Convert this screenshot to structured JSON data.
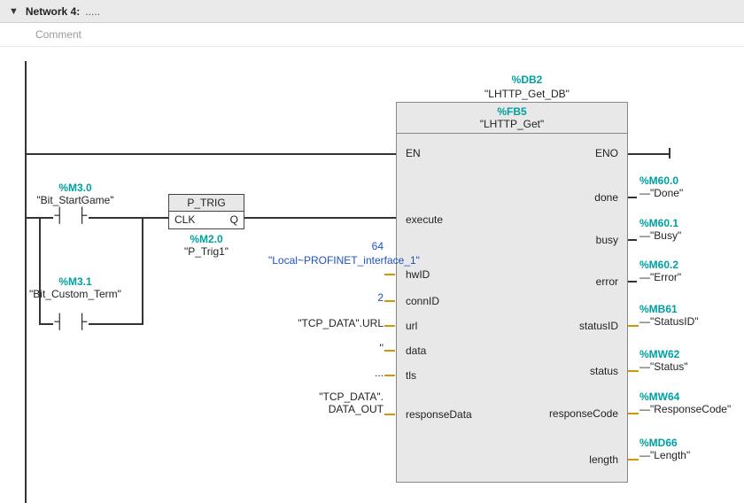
{
  "header": {
    "network_label": "Network 4:",
    "dots": ".....",
    "comment_placeholder": "Comment"
  },
  "left_rung": {
    "contact1": {
      "address": "%M3.0",
      "symbol": "\"Bit_StartGame\""
    },
    "contact2": {
      "address": "%M3.1",
      "symbol": "\"Bit_Custom_Term\""
    },
    "ptrig": {
      "title": "P_TRIG",
      "clk": "CLK",
      "q": "Q",
      "inst_addr": "%M2.0",
      "inst_sym": "\"P_Trig1\""
    }
  },
  "block": {
    "db_addr": "%DB2",
    "db_sym": "\"LHTTP_Get_DB\"",
    "fb_addr": "%FB5",
    "fb_sym": "\"LHTTP_Get\"",
    "ports_left": {
      "en": "EN",
      "execute": "execute",
      "hwid": "hwID",
      "connid": "connID",
      "url": "url",
      "data": "data",
      "tls": "tls",
      "responseData": "responseData"
    },
    "ports_right": {
      "eno": "ENO",
      "done": "done",
      "busy": "busy",
      "error": "error",
      "statusid": "statusID",
      "status": "status",
      "responseCode": "responseCode",
      "length": "length"
    }
  },
  "inputs": {
    "hwid_val": "64",
    "hwid_sym": "\"Local~PROFINET_interface_1\"",
    "connid_val": "2",
    "url_sym": "\"TCP_DATA\".URL",
    "data_val": "''",
    "tls_val": "...",
    "responseData_sym1": "\"TCP_DATA\".",
    "responseData_sym2": "DATA_OUT"
  },
  "outputs": {
    "done": {
      "addr": "%M60.0",
      "sym": "\"Done\""
    },
    "busy": {
      "addr": "%M60.1",
      "sym": "\"Busy\""
    },
    "error": {
      "addr": "%M60.2",
      "sym": "\"Error\""
    },
    "statusid": {
      "addr": "%MB61",
      "sym": "\"StatusID\""
    },
    "status": {
      "addr": "%MW62",
      "sym": "\"Status\""
    },
    "responsecode": {
      "addr": "%MW64",
      "sym": "\"ResponseCode\""
    },
    "length": {
      "addr": "%MD66",
      "sym": "\"Length\""
    }
  },
  "dash": "—"
}
